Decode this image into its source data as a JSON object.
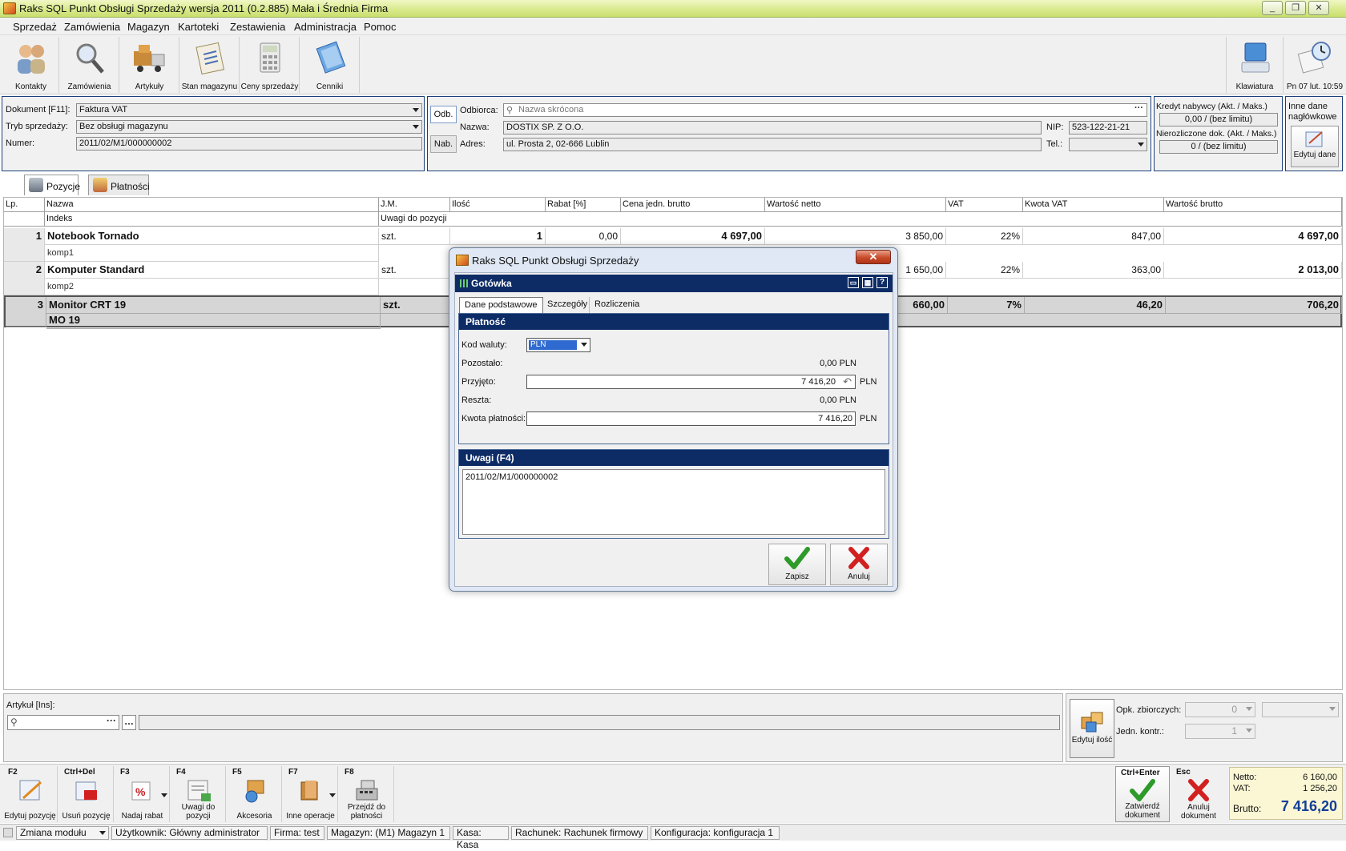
{
  "window": {
    "title": "Raks SQL Punkt Obsługi Sprzedaży wersja 2011 (0.2.885) Mała i Średnia Firma"
  },
  "menu": [
    "Sprzedaż",
    "Zamówienia",
    "Magazyn",
    "Kartoteki",
    "Zestawienia",
    "Administracja",
    "Pomoc"
  ],
  "toolbar": {
    "buttons": [
      "Kontakty",
      "Zamówienia",
      "Artykuły",
      "Stan magazynu",
      "Ceny sprzedaży",
      "Cenniki"
    ],
    "keyboard_label": "Klawiatura",
    "datetime": "Pn 07 lut. 10:59"
  },
  "header": {
    "doc_label": "Dokument [F11]:",
    "doc_value": "Faktura VAT",
    "mode_label": "Tryb sprzedaży:",
    "mode_value": "Bez obsługi magazynu",
    "number_label": "Numer:",
    "number_value": "2011/02/M1/000000002",
    "tab_odb": "Odb.",
    "tab_nab": "Nab.",
    "recipient_label": "Odbiorca:",
    "recipient_placeholder": "Nazwa skrócona",
    "name_label": "Nazwa:",
    "name_value": "DOSTIX SP. Z O.O.",
    "address_label": "Adres:",
    "address_value": "ul. Prosta 2, 02-666 Lublin",
    "nip_label": "NIP:",
    "nip_value": "523-122-21-21",
    "tel_label": "Tel.:",
    "tel_value": "",
    "credit_label": "Kredyt nabywcy (Akt. / Maks.)",
    "credit_value": "0,00 / (bez limitu)",
    "unsettled_label": "Nierozliczone dok. (Akt. / Maks.)",
    "unsettled_value": "0 / (bez limitu)",
    "other_label": "Inne dane nagłówkowe",
    "edit_label": "Edytuj dane"
  },
  "tabs": [
    "Pozycje",
    "Płatności"
  ],
  "grid": {
    "headers": [
      "Lp.",
      "Nazwa",
      "J.M.",
      "Ilość",
      "Rabat [%]",
      "Cena jedn. brutto",
      "Wartość netto",
      "VAT",
      "Kwota VAT",
      "Wartość brutto"
    ],
    "subheaders": [
      "Indeks",
      "Uwagi do pozycji"
    ],
    "rows": [
      {
        "lp": "1",
        "name": "Notebook Tornado",
        "index": "komp1",
        "unit": "szt.",
        "qty": "1",
        "discount": "0,00",
        "price": "4 697,00",
        "net": "3 850,00",
        "vat": "22%",
        "vat_amount": "847,00",
        "gross": "4 697,00"
      },
      {
        "lp": "2",
        "name": "Komputer Standard",
        "index": "komp2",
        "unit": "szt.",
        "qty": "",
        "discount": "",
        "price": "",
        "net": "1 650,00",
        "vat": "22%",
        "vat_amount": "363,00",
        "gross": "2 013,00"
      },
      {
        "lp": "3",
        "name": "Monitor CRT 19",
        "index": "MO 19",
        "unit": "szt.",
        "qty": "",
        "discount": "",
        "price": "",
        "net": "660,00",
        "vat": "7%",
        "vat_amount": "46,20",
        "gross": "706,20"
      }
    ]
  },
  "dialog": {
    "title": "Raks SQL Punkt Obsługi Sprzedaży",
    "heading": "Gotówka",
    "payment_section": "Płatność",
    "currency_label": "Kod waluty:",
    "currency_value": "PLN",
    "remaining_label": "Pozostało:",
    "remaining_value": "0,00 PLN",
    "received_label": "Przyjęto:",
    "received_value": "7 416,20",
    "received_unit": "PLN",
    "change_label": "Reszta:",
    "change_value": "0,00 PLN",
    "amount_label": "Kwota płatności:",
    "amount_value": "7 416,20",
    "amount_unit": "PLN",
    "notes_section": "Uwagi (F4)",
    "notes_value": "2011/02/M1/000000002",
    "tabs": [
      "Dane podstawowe",
      "Szczegóły",
      "Rozliczenia"
    ],
    "save": "Zapisz",
    "cancel": "Anuluj"
  },
  "article": {
    "label": "Artykuł [Ins]:",
    "bulk_label": "Opk. zbiorczych:",
    "bulk_value": "0",
    "control_label": "Jedn. kontr.:",
    "control_value": "1",
    "edit_qty": "Edytuj ilość"
  },
  "fbuttons": [
    {
      "key": "F2",
      "label": "Edytuj pozycję"
    },
    {
      "key": "Ctrl+Del",
      "label": "Usuń pozycję"
    },
    {
      "key": "F3",
      "label": "Nadaj rabat"
    },
    {
      "key": "F4",
      "label": "Uwagi do pozycji"
    },
    {
      "key": "F5",
      "label": "Akcesoria"
    },
    {
      "key": "F7",
      "label": "Inne operacje"
    },
    {
      "key": "F8",
      "label": "Przejdź do płatności"
    }
  ],
  "confirm": {
    "key": "Ctrl+Enter",
    "label": "Zatwierdź dokument"
  },
  "cancel_doc": {
    "key": "Esc",
    "label": "Anuluj dokument"
  },
  "totals": {
    "net_label": "Netto:",
    "net": "6 160,00",
    "vat_label": "VAT:",
    "vat": "1 256,20",
    "gross_label": "Brutto:",
    "gross": "7 416,20"
  },
  "status": [
    "Zmiana modułu",
    "Użytkownik: Główny administrator",
    "Firma: test",
    "Magazyn: (M1) Magazyn 1",
    "Kasa: Kasa",
    "Rachunek: Rachunek firmowy",
    "Konfiguracja: konfiguracja 1"
  ]
}
